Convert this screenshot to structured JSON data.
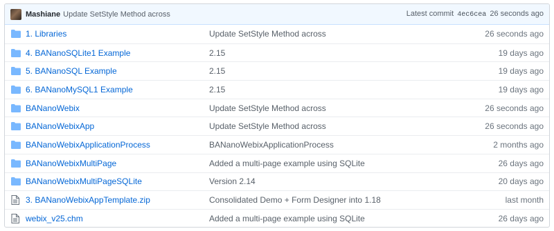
{
  "commit": {
    "author": "Mashiane",
    "message": "Update SetStyle Method across",
    "latest_label": "Latest commit",
    "sha": "4ec6cea",
    "age": "26 seconds ago"
  },
  "files": [
    {
      "type": "dir",
      "icon": "folder-icon",
      "name": "1. Libraries",
      "message": "Update SetStyle Method across",
      "age": "26 seconds ago"
    },
    {
      "type": "dir",
      "icon": "folder-icon",
      "name": "4. BANanoSQLite1 Example",
      "message": "2.15",
      "age": "19 days ago"
    },
    {
      "type": "dir",
      "icon": "folder-icon",
      "name": "5. BANanoSQL Example",
      "message": "2.15",
      "age": "19 days ago"
    },
    {
      "type": "dir",
      "icon": "folder-icon",
      "name": "6. BANanoMySQL1 Example",
      "message": "2.15",
      "age": "19 days ago"
    },
    {
      "type": "dir",
      "icon": "folder-icon",
      "name": "BANanoWebix",
      "message": "Update SetStyle Method across",
      "age": "26 seconds ago"
    },
    {
      "type": "dir",
      "icon": "folder-icon",
      "name": "BANanoWebixApp",
      "message": "Update SetStyle Method across",
      "age": "26 seconds ago"
    },
    {
      "type": "dir",
      "icon": "folder-icon",
      "name": "BANanoWebixApplicationProcess",
      "message": "BANanoWebixApplicationProcess",
      "age": "2 months ago"
    },
    {
      "type": "dir",
      "icon": "folder-icon",
      "name": "BANanoWebixMultiPage",
      "message": "Added a multi-page example using SQLite",
      "age": "26 days ago"
    },
    {
      "type": "dir",
      "icon": "folder-icon",
      "name": "BANanoWebixMultiPageSQLite",
      "message": "Version 2.14",
      "age": "20 days ago"
    },
    {
      "type": "file",
      "icon": "file-icon",
      "name": "3. BANanoWebixAppTemplate.zip",
      "message": "Consolidated Demo + Form Designer into 1.18",
      "age": "last month"
    },
    {
      "type": "file",
      "icon": "file-icon",
      "name": "webix_v25.chm",
      "message": "Added a multi-page example using SQLite",
      "age": "26 days ago"
    }
  ],
  "colors": {
    "link": "#0366d6",
    "folder": "#79b8ff",
    "file": "#6a737d",
    "commit_bar": "#f1f8ff"
  }
}
